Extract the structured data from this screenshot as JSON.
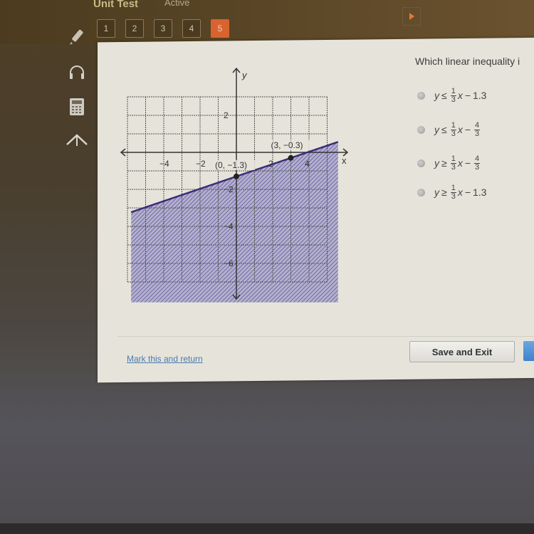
{
  "header": {
    "test_title": "Unit Test",
    "status": "Active",
    "question_nav": [
      {
        "label": "1",
        "active": false
      },
      {
        "label": "2",
        "active": false
      },
      {
        "label": "3",
        "active": false
      },
      {
        "label": "4",
        "active": false
      },
      {
        "label": "5",
        "active": true
      }
    ],
    "next_arrow_icon": "play-triangle-icon"
  },
  "tools": [
    {
      "name": "pencil",
      "icon": "pencil-icon"
    },
    {
      "name": "audio",
      "icon": "headphones-icon"
    },
    {
      "name": "calculator",
      "icon": "calculator-icon"
    },
    {
      "name": "reference",
      "icon": "caret-up-icon"
    }
  ],
  "question": {
    "text": "Which linear inequality i",
    "options": [
      {
        "relation": "≤",
        "coef_num": "1",
        "coef_den": "3",
        "var": "x",
        "const_type": "decimal",
        "const": "1.3"
      },
      {
        "relation": "≤",
        "coef_num": "1",
        "coef_den": "3",
        "var": "x",
        "const_type": "fraction",
        "const_num": "4",
        "const_den": "3"
      },
      {
        "relation": "≥",
        "coef_num": "1",
        "coef_den": "3",
        "var": "x",
        "const_type": "fraction",
        "const_num": "4",
        "const_den": "3"
      },
      {
        "relation": "≥",
        "coef_num": "1",
        "coef_den": "3",
        "var": "x",
        "const_type": "decimal",
        "const": "1.3"
      }
    ]
  },
  "footer": {
    "mark_link": "Mark this and return",
    "save_exit": "Save and Exit"
  },
  "chart_data": {
    "type": "line",
    "title": "",
    "xlabel": "x",
    "ylabel": "y",
    "xlim": [
      -5,
      5
    ],
    "ylim": [
      -8,
      3
    ],
    "x_ticks": [
      -4,
      -2,
      2,
      4
    ],
    "x_tick_labels": [
      "-4",
      "-2",
      "2",
      "4"
    ],
    "y_ticks": [
      2,
      -2,
      -4,
      -6
    ],
    "y_tick_labels": [
      "2",
      "-2",
      "-4",
      "-6"
    ],
    "grid": true,
    "boundary_line": {
      "slope": 0.3333,
      "intercept": -1.3,
      "style": "solid",
      "color": "#3c2c7a"
    },
    "shading": "below",
    "shade_color": "#6f68a8",
    "points": [
      {
        "x": 0,
        "y": -1.3,
        "label": "(0, -1.3)"
      },
      {
        "x": 3,
        "y": -0.3,
        "label": "(3, -0.3)"
      }
    ]
  }
}
